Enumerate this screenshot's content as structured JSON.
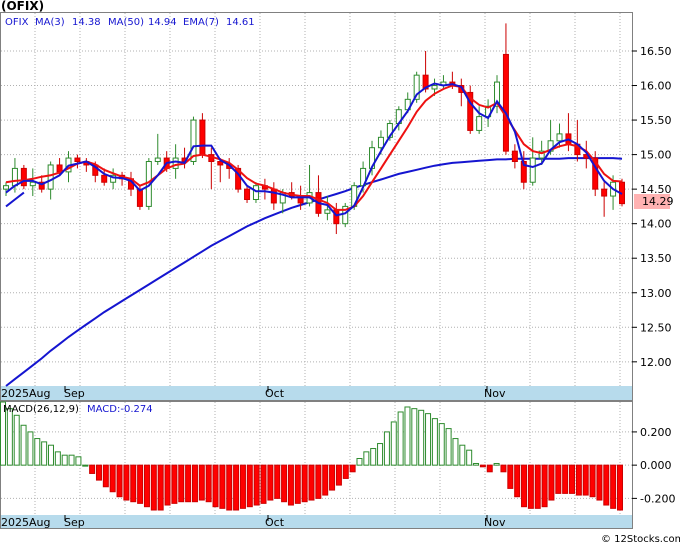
{
  "title": "(OFIX)",
  "price_legend": {
    "ticker": "OFIX",
    "ma3_label": "MA(3)",
    "ma3_value": "14.38",
    "ma50_label": "MA(50)",
    "ma50_value": "14.94",
    "ema7_label": "EMA(7)",
    "ema7_value": "14.61"
  },
  "macd_legend": {
    "label": "MACD(26,12,9)",
    "value_label": "MACD:-0.274"
  },
  "last_price_tag": "14.29",
  "credit": "© 12Stocks.com",
  "x_labels": [
    "2025Aug",
    "Sep",
    "Oct",
    "Nov"
  ],
  "colors": {
    "up": "#2e8b2e",
    "down": "#ff0000",
    "ma_blue": "#1515d0",
    "ema_red": "#ee1111",
    "axis_band": "#b7dbec",
    "grid": "#b0b0b0"
  },
  "chart_data": {
    "type": "candlestick",
    "price_axis": {
      "ticks": [
        "16.50",
        "16.00",
        "15.50",
        "15.00",
        "14.50",
        "14.00",
        "13.50",
        "13.00",
        "12.50",
        "12.00"
      ],
      "ylim": [
        11.65,
        17.05
      ]
    },
    "ohlc": [
      [
        14.5,
        14.6,
        14.4,
        14.55
      ],
      [
        14.55,
        14.95,
        14.45,
        14.8
      ],
      [
        14.8,
        14.85,
        14.5,
        14.55
      ],
      [
        14.55,
        14.8,
        14.4,
        14.6
      ],
      [
        14.6,
        14.7,
        14.45,
        14.5
      ],
      [
        14.5,
        14.9,
        14.35,
        14.85
      ],
      [
        14.85,
        14.95,
        14.7,
        14.75
      ],
      [
        14.75,
        15.05,
        14.6,
        14.95
      ],
      [
        14.95,
        15.0,
        14.8,
        14.9
      ],
      [
        14.9,
        14.95,
        14.75,
        14.85
      ],
      [
        14.85,
        14.9,
        14.6,
        14.7
      ],
      [
        14.7,
        14.8,
        14.55,
        14.6
      ],
      [
        14.6,
        14.8,
        14.5,
        14.7
      ],
      [
        14.7,
        14.75,
        14.55,
        14.65
      ],
      [
        14.65,
        14.75,
        14.4,
        14.5
      ],
      [
        14.5,
        14.55,
        14.2,
        14.25
      ],
      [
        14.25,
        14.95,
        14.2,
        14.9
      ],
      [
        14.9,
        15.3,
        14.85,
        14.95
      ],
      [
        14.95,
        15.05,
        14.75,
        14.8
      ],
      [
        14.8,
        15.15,
        14.65,
        14.95
      ],
      [
        14.95,
        15.1,
        14.8,
        14.9
      ],
      [
        14.9,
        15.55,
        14.85,
        15.5
      ],
      [
        15.5,
        15.6,
        14.95,
        15.0
      ],
      [
        15.0,
        15.1,
        14.5,
        14.9
      ],
      [
        14.9,
        14.95,
        14.6,
        14.85
      ],
      [
        14.85,
        14.95,
        14.65,
        14.8
      ],
      [
        14.8,
        14.85,
        14.45,
        14.5
      ],
      [
        14.5,
        14.55,
        14.3,
        14.35
      ],
      [
        14.35,
        14.6,
        14.3,
        14.55
      ],
      [
        14.55,
        14.65,
        14.35,
        14.5
      ],
      [
        14.5,
        14.6,
        14.2,
        14.3
      ],
      [
        14.3,
        14.5,
        14.15,
        14.45
      ],
      [
        14.45,
        14.6,
        14.35,
        14.4
      ],
      [
        14.4,
        14.55,
        14.2,
        14.3
      ],
      [
        14.3,
        14.85,
        14.25,
        14.45
      ],
      [
        14.45,
        14.7,
        14.1,
        14.15
      ],
      [
        14.15,
        14.4,
        14.05,
        14.2
      ],
      [
        14.2,
        14.3,
        13.85,
        14.0
      ],
      [
        14.0,
        14.3,
        13.95,
        14.25
      ],
      [
        14.25,
        14.6,
        14.2,
        14.55
      ],
      [
        14.55,
        14.9,
        14.45,
        14.8
      ],
      [
        14.8,
        15.2,
        14.7,
        15.1
      ],
      [
        15.1,
        15.35,
        15.0,
        15.25
      ],
      [
        15.25,
        15.5,
        15.2,
        15.45
      ],
      [
        15.45,
        15.7,
        15.35,
        15.65
      ],
      [
        15.65,
        15.9,
        15.6,
        15.8
      ],
      [
        15.8,
        16.2,
        15.75,
        16.15
      ],
      [
        16.15,
        16.5,
        15.9,
        15.95
      ],
      [
        15.95,
        16.1,
        15.85,
        16.0
      ],
      [
        16.0,
        16.15,
        15.95,
        16.05
      ],
      [
        16.05,
        16.2,
        15.95,
        16.0
      ],
      [
        16.0,
        16.1,
        15.7,
        15.9
      ],
      [
        15.9,
        16.0,
        15.3,
        15.35
      ],
      [
        15.35,
        15.7,
        15.3,
        15.55
      ],
      [
        15.55,
        15.8,
        15.4,
        15.7
      ],
      [
        15.7,
        16.15,
        15.6,
        16.05
      ],
      [
        16.45,
        16.9,
        15.0,
        15.05
      ],
      [
        15.05,
        15.15,
        14.8,
        14.9
      ],
      [
        14.9,
        15.05,
        14.5,
        14.6
      ],
      [
        14.6,
        15.25,
        14.55,
        14.95
      ],
      [
        14.95,
        15.2,
        14.85,
        15.05
      ],
      [
        15.05,
        15.5,
        15.0,
        15.2
      ],
      [
        15.2,
        15.45,
        15.1,
        15.3
      ],
      [
        15.3,
        15.6,
        15.05,
        15.15
      ],
      [
        15.15,
        15.5,
        14.9,
        15.0
      ],
      [
        15.0,
        15.2,
        14.8,
        14.95
      ],
      [
        14.95,
        15.05,
        14.4,
        14.5
      ],
      [
        14.5,
        14.6,
        14.1,
        14.4
      ],
      [
        14.4,
        14.7,
        14.2,
        14.6
      ],
      [
        14.6,
        14.65,
        14.25,
        14.29
      ]
    ],
    "ma3": [
      14.45,
      14.55,
      14.62,
      14.62,
      14.57,
      14.63,
      14.7,
      14.84,
      14.87,
      14.9,
      14.82,
      14.72,
      14.67,
      14.66,
      14.62,
      14.48,
      14.55,
      14.7,
      14.88,
      14.9,
      14.88,
      15.12,
      15.13,
      15.13,
      14.92,
      14.85,
      14.72,
      14.55,
      14.47,
      14.47,
      14.45,
      14.42,
      14.38,
      14.38,
      14.38,
      14.3,
      14.27,
      14.12,
      14.15,
      14.26,
      14.53,
      14.82,
      15.05,
      15.27,
      15.45,
      15.63,
      15.87,
      15.97,
      16.03,
      16.0,
      16.02,
      15.98,
      15.75,
      15.6,
      15.53,
      15.77,
      15.6,
      15.33,
      14.85,
      14.82,
      14.87,
      15.07,
      15.18,
      15.22,
      15.15,
      15.03,
      14.82,
      14.62,
      14.5,
      14.43
    ],
    "ema7": [
      14.6,
      14.62,
      14.63,
      14.65,
      14.68,
      14.7,
      14.74,
      14.8,
      14.87,
      14.9,
      14.86,
      14.78,
      14.73,
      14.68,
      14.65,
      14.55,
      14.6,
      14.7,
      14.8,
      14.85,
      14.87,
      14.98,
      15.0,
      14.97,
      14.93,
      14.88,
      14.78,
      14.66,
      14.58,
      14.55,
      14.5,
      14.45,
      14.42,
      14.4,
      14.4,
      14.35,
      14.3,
      14.2,
      14.2,
      14.25,
      14.4,
      14.6,
      14.8,
      15.0,
      15.2,
      15.4,
      15.62,
      15.78,
      15.88,
      15.95,
      16.0,
      15.98,
      15.82,
      15.72,
      15.68,
      15.75,
      15.55,
      15.35,
      15.15,
      15.05,
      15.02,
      15.07,
      15.12,
      15.15,
      15.12,
      15.05,
      14.9,
      14.72,
      14.62,
      14.61
    ],
    "ma50": [
      11.65,
      11.75,
      11.85,
      11.95,
      12.05,
      12.16,
      12.26,
      12.36,
      12.45,
      12.54,
      12.63,
      12.72,
      12.8,
      12.88,
      12.96,
      13.04,
      13.12,
      13.2,
      13.28,
      13.36,
      13.44,
      13.52,
      13.6,
      13.68,
      13.75,
      13.82,
      13.89,
      13.96,
      14.02,
      14.08,
      14.13,
      14.18,
      14.23,
      14.27,
      14.31,
      14.35,
      14.39,
      14.43,
      14.47,
      14.52,
      14.56,
      14.6,
      14.64,
      14.68,
      14.72,
      14.75,
      14.78,
      14.81,
      14.84,
      14.86,
      14.88,
      14.89,
      14.9,
      14.91,
      14.92,
      14.93,
      14.93,
      14.94,
      14.94,
      14.94,
      14.94,
      14.94,
      14.94,
      14.95,
      14.95,
      14.95,
      14.95,
      14.95,
      14.95,
      14.94
    ],
    "ma50_earlier": [
      14.25,
      14.35,
      14.45
    ],
    "macd_axis": {
      "ticks": [
        "0.200",
        "0.000",
        "-0.200"
      ],
      "ylim": [
        -0.3,
        0.38
      ]
    },
    "macd": [
      0.38,
      0.34,
      0.3,
      0.24,
      0.2,
      0.16,
      0.14,
      0.12,
      0.08,
      0.06,
      0.06,
      0.05,
      0.0,
      -0.05,
      -0.09,
      -0.13,
      -0.16,
      -0.19,
      -0.21,
      -0.22,
      -0.23,
      -0.25,
      -0.27,
      -0.27,
      -0.24,
      -0.23,
      -0.22,
      -0.22,
      -0.22,
      -0.21,
      -0.22,
      -0.25,
      -0.26,
      -0.27,
      -0.27,
      -0.26,
      -0.25,
      -0.24,
      -0.23,
      -0.21,
      -0.2,
      -0.22,
      -0.24,
      -0.23,
      -0.22,
      -0.21,
      -0.2,
      -0.18,
      -0.15,
      -0.12,
      -0.08,
      -0.04,
      0.04,
      0.08,
      0.1,
      0.13,
      0.2,
      0.26,
      0.32,
      0.35,
      0.34,
      0.33,
      0.31,
      0.28,
      0.25,
      0.22,
      0.16,
      0.12,
      0.09,
      0.01,
      -0.01,
      -0.04,
      0.01,
      -0.04,
      -0.14,
      -0.19,
      -0.25,
      -0.26,
      -0.26,
      -0.25,
      -0.21,
      -0.17,
      -0.17,
      -0.17,
      -0.18,
      -0.18,
      -0.19,
      -0.21,
      -0.24,
      -0.26,
      -0.27
    ]
  }
}
